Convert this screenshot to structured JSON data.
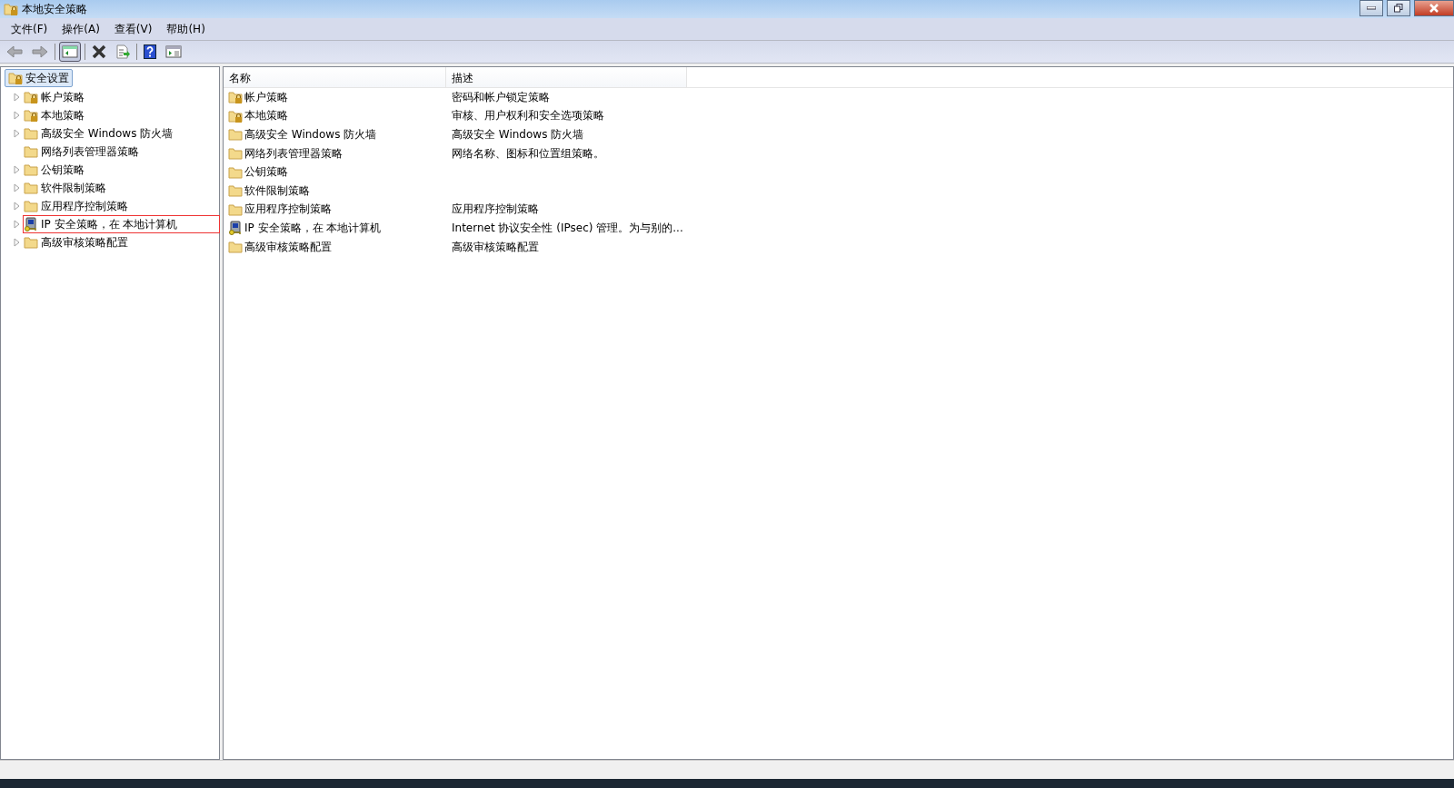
{
  "window": {
    "title": "本地安全策略"
  },
  "menu": [
    "文件(F)",
    "操作(A)",
    "查看(V)",
    "帮助(H)"
  ],
  "toolbar": [
    {
      "kind": "back",
      "disabled": true
    },
    {
      "kind": "forward",
      "disabled": true
    },
    {
      "kind": "sep"
    },
    {
      "kind": "tree",
      "selected": true
    },
    {
      "kind": "sep"
    },
    {
      "kind": "delete",
      "disabled": false
    },
    {
      "kind": "export",
      "disabled": false
    },
    {
      "kind": "sep"
    },
    {
      "kind": "help",
      "disabled": false
    },
    {
      "kind": "panel",
      "disabled": false
    }
  ],
  "tree": {
    "root": {
      "label": "安全设置",
      "selected": true
    },
    "children": [
      {
        "label": "帐户策略",
        "kind": "lock",
        "expandable": true,
        "highlighted": false
      },
      {
        "label": "本地策略",
        "kind": "lock",
        "expandable": true,
        "highlighted": false
      },
      {
        "label": "高级安全 Windows 防火墙",
        "kind": "folder",
        "expandable": true,
        "highlighted": false
      },
      {
        "label": "网络列表管理器策略",
        "kind": "folder",
        "expandable": false,
        "highlighted": false
      },
      {
        "label": "公钥策略",
        "kind": "folder",
        "expandable": true,
        "highlighted": false
      },
      {
        "label": "软件限制策略",
        "kind": "folder",
        "expandable": true,
        "highlighted": false
      },
      {
        "label": "应用程序控制策略",
        "kind": "folder",
        "expandable": true,
        "highlighted": false
      },
      {
        "label": "IP 安全策略，在 本地计算机",
        "kind": "ipsec",
        "expandable": true,
        "highlighted": true
      },
      {
        "label": "高级审核策略配置",
        "kind": "folder",
        "expandable": true,
        "highlighted": false
      }
    ]
  },
  "table": {
    "columns": [
      "名称",
      "描述"
    ],
    "rows": [
      {
        "kind": "lock",
        "name": "帐户策略",
        "description": "密码和帐户锁定策略"
      },
      {
        "kind": "lock",
        "name": "本地策略",
        "description": "审核、用户权利和安全选项策略"
      },
      {
        "kind": "folder",
        "name": "高级安全 Windows 防火墙",
        "description": "高级安全 Windows 防火墙"
      },
      {
        "kind": "folder",
        "name": "网络列表管理器策略",
        "description": "网络名称、图标和位置组策略。"
      },
      {
        "kind": "folder",
        "name": "公钥策略"
      },
      {
        "kind": "folder",
        "name": "软件限制策略"
      },
      {
        "kind": "folder",
        "name": "应用程序控制策略",
        "description": "应用程序控制策略"
      },
      {
        "kind": "ipsec",
        "name": "IP 安全策略，在 本地计算机",
        "description": "Internet 协议安全性 (IPsec) 管理。为与别的..."
      },
      {
        "kind": "folder",
        "name": "高级审核策略配置",
        "description": "高级审核策略配置"
      }
    ]
  }
}
